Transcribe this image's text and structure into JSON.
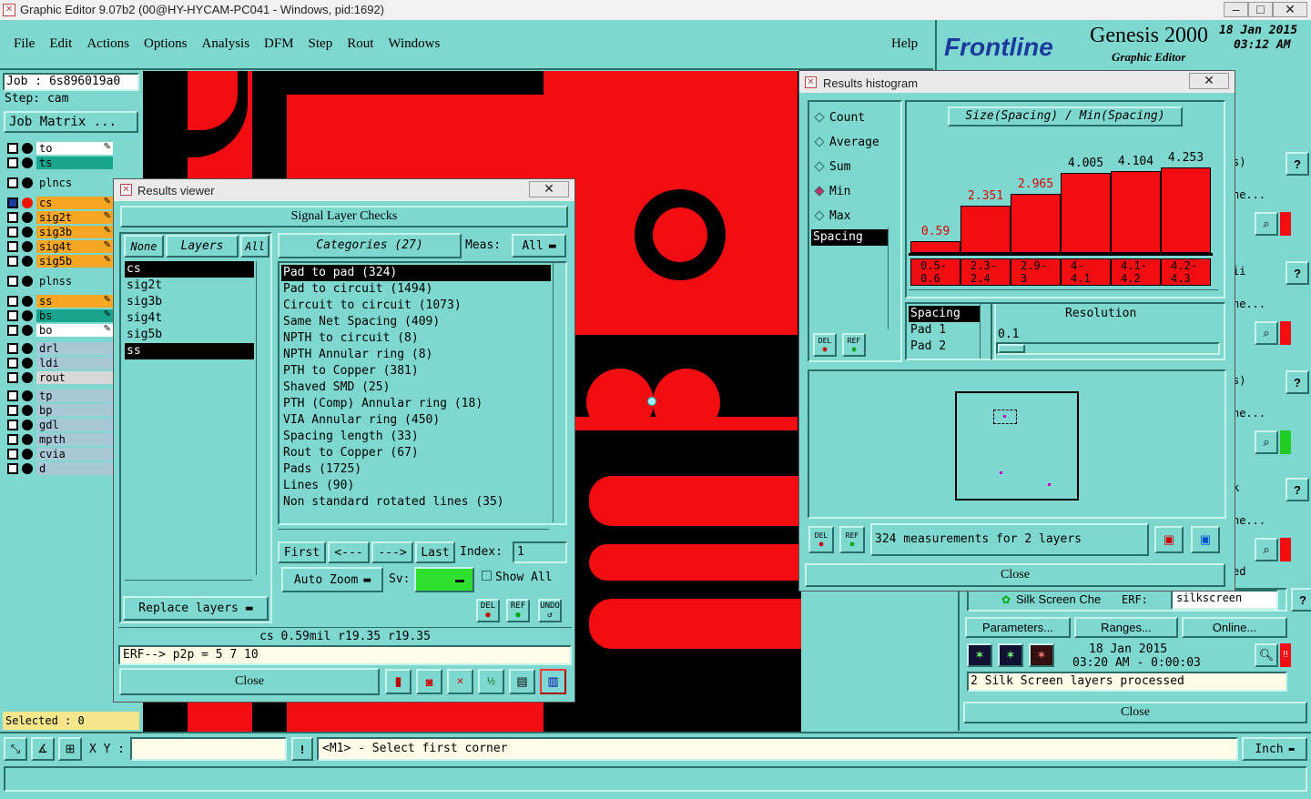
{
  "app": {
    "title": "Graphic Editor 9.07b2 (00@HY-HYCAM-PC041 - Windows, pid:1692)",
    "menu": [
      "File",
      "Edit",
      "Actions",
      "Options",
      "Analysis",
      "DFM",
      "Step",
      "Rout",
      "Windows"
    ],
    "help": "Help",
    "brand": {
      "logo": "Frontline",
      "product": "Genesis 2000",
      "subtitle": "Graphic Editor",
      "date": "18 Jan 2015",
      "time": "03:12 AM"
    }
  },
  "left": {
    "job": "Job : 6s896019a0",
    "step": "Step: cam",
    "job_matrix": "Job Matrix ...",
    "layers": [
      {
        "name": "to",
        "color": "#ffffff"
      },
      {
        "name": "ts",
        "color": "#17a58d"
      },
      {
        "name": "plncs",
        "color": "#7fd8d0"
      },
      {
        "name": "cs",
        "color": "#f5a623"
      },
      {
        "name": "sig2t",
        "color": "#f5a623"
      },
      {
        "name": "sig3b",
        "color": "#f5a623"
      },
      {
        "name": "sig4t",
        "color": "#f5a623"
      },
      {
        "name": "sig5b",
        "color": "#f5a623"
      },
      {
        "name": "plnss",
        "color": "#7fd8d0"
      },
      {
        "name": "ss",
        "color": "#f5a623"
      },
      {
        "name": "bs",
        "color": "#17a58d"
      },
      {
        "name": "bo",
        "color": "#ffffff"
      },
      {
        "name": "drl",
        "color": "#a8c8d8"
      },
      {
        "name": "ldi",
        "color": "#a8c8d8"
      },
      {
        "name": "rout",
        "color": "#d8d8d8"
      },
      {
        "name": "tp",
        "color": "#a8c8d8"
      },
      {
        "name": "bp",
        "color": "#a8c8d8"
      },
      {
        "name": "gdl",
        "color": "#a8c8d8"
      },
      {
        "name": "mpth",
        "color": "#a8c8d8"
      },
      {
        "name": "cvia",
        "color": "#a8c8d8"
      },
      {
        "name": "d",
        "color": "#a8c8d8"
      }
    ],
    "selected": "Selected : 0"
  },
  "results_viewer": {
    "title": "Results viewer",
    "header": "Signal Layer Checks",
    "none_btn": "None",
    "layers_btn": "Layers",
    "all_btn": "All",
    "categories_btn": "Categories (27)",
    "meas_label": "Meas:",
    "meas_value": "All",
    "layers": [
      "cs",
      "sig2t",
      "sig3b",
      "sig4t",
      "sig5b",
      "ss"
    ],
    "categories": [
      "Pad to pad (324)",
      "Pad to circuit (1494)",
      "Circuit to circuit (1073)",
      "Same Net Spacing (409)",
      "NPTH to circuit (8)",
      "NPTH Annular ring (8)",
      "PTH to Copper (381)",
      "Shaved SMD (25)",
      "PTH (Comp) Annular ring (18)",
      "VIA Annular ring (450)",
      "Spacing length (33)",
      "Rout to Copper (67)",
      "Pads (1725)",
      "Lines (90)",
      "Non standard rotated lines (35)"
    ],
    "nav": {
      "first": "First",
      "prev": "<---",
      "next": "--->",
      "last": "Last",
      "index_label": "Index:",
      "index_value": "1"
    },
    "auto_zoom": "Auto Zoom",
    "sv_label": "Sv:",
    "show_all": "Show All",
    "replace_layers": "Replace layers",
    "del": "DEL",
    "ref": "REF",
    "undo": "UNDO",
    "status1": "cs 0.59mil  r19.35  r19.35",
    "status2": "ERF--> p2p = 5 7 10",
    "close": "Close"
  },
  "histogram": {
    "title": "Results histogram",
    "options": [
      "Count",
      "Average",
      "Sum",
      "Min",
      "Max"
    ],
    "selected_option": "Min",
    "chart_title": "Size(Spacing) / Min(Spacing)",
    "measure_list": [
      "Spacing"
    ],
    "attr_list": [
      "Spacing",
      "Pad 1",
      "Pad 2"
    ],
    "resolution_label": "Resolution",
    "resolution_value": "0.1",
    "measurements": "324 measurements for 2 layers",
    "close": "Close",
    "del": "DEL",
    "ref": "REF"
  },
  "chart_data": {
    "type": "bar",
    "title": "Size(Spacing) / Min(Spacing)",
    "categories": [
      "0.5-0.6",
      "2.3-2.4",
      "2.9-3",
      "4-4.1",
      "4.1-4.2",
      "4.2-4.3"
    ],
    "category_labels": [
      [
        "0.5-",
        "0.6"
      ],
      [
        "2.3-",
        "2.4"
      ],
      [
        "2.9-",
        "3"
      ],
      [
        "4-",
        "4.1"
      ],
      [
        "4.1-",
        "4.2"
      ],
      [
        "4.2-",
        "4.3"
      ]
    ],
    "values": [
      0.59,
      2.351,
      2.965,
      4.005,
      4.104,
      4.253
    ],
    "value_labels": [
      "0.59",
      "2.351",
      "2.965",
      "4.005",
      "4.104",
      "4.253"
    ],
    "ylim": [
      0,
      5
    ],
    "bar_color": "#f10d12"
  },
  "right_panel": {
    "fields": [
      "s)",
      "ne...",
      "ii",
      "ne...",
      "s)",
      "ne...",
      "k",
      "ne...",
      "ed"
    ],
    "silk_label": "Silk Screen Che",
    "erf_label": "ERF:",
    "erf_value": "silkscreen",
    "parameters": "Parameters...",
    "ranges": "Ranges...",
    "online": "Online...",
    "date": "18 Jan 2015",
    "time": "03:20 AM - 0:00:03",
    "status": "2 Silk Screen layers processed",
    "close": "Close"
  },
  "bottom": {
    "xy_label": "X Y :",
    "xy_value": "",
    "prompt": "<M1> - Select first corner",
    "units": "Inch"
  }
}
